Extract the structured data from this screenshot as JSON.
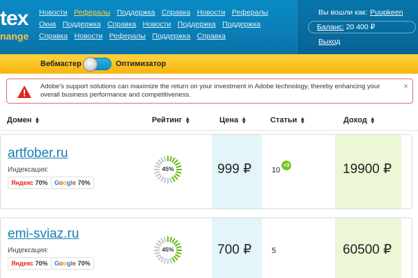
{
  "header": {
    "logo_main": "tex",
    "logo_sub": "nange",
    "nav_items": [
      {
        "label": "Новости",
        "active": false
      },
      {
        "label": "Рефералы",
        "active": true
      },
      {
        "label": "Поддержка",
        "active": false
      },
      {
        "label": "Справка",
        "active": false
      },
      {
        "label": "Новости",
        "active": false
      },
      {
        "label": "Рефералы",
        "active": false
      },
      {
        "label": "Окна",
        "active": false
      },
      {
        "label": "Поддержка",
        "active": false
      },
      {
        "label": "Справка",
        "active": false
      },
      {
        "label": "Новости",
        "active": false
      },
      {
        "label": "Поддержка",
        "active": false
      },
      {
        "label": "Поддержка",
        "active": false
      },
      {
        "label": "Справка",
        "active": false
      },
      {
        "label": "Новости",
        "active": false
      },
      {
        "label": "Рефералы",
        "active": false
      },
      {
        "label": "Поддержка",
        "active": false
      },
      {
        "label": "Справка",
        "active": false
      }
    ],
    "user": {
      "logged_in_label": "Вы вошли как:",
      "username": "Puupkeen",
      "balance_label": "Баланс:",
      "balance_value": "20 400 ₽",
      "logout_label": "Выход"
    }
  },
  "mode_toggle": {
    "left_label": "Вебмастер",
    "right_label": "Оптимизатор"
  },
  "alert": {
    "text": "Adobe's support solutions can maximize the return on your investment in Adobe technology, thereby enhancing your overall business performance and competitiveness.",
    "close_label": "×"
  },
  "table": {
    "headers": {
      "domain": "Домен",
      "rating": "Рейтинг",
      "price": "Цена",
      "articles": "Статьи",
      "income": "Доход"
    },
    "rows": [
      {
        "domain": "artfober.ru",
        "index_label": "Индексация:",
        "yandex": "70%",
        "google": "70%",
        "rating_percent": 45,
        "rating_label": "45%",
        "price": "999 ₽",
        "articles": "10",
        "articles_badge": "+3",
        "income": "19900 ₽"
      },
      {
        "domain": "emi-sviaz.ru",
        "index_label": "Индексация:",
        "yandex": "70%",
        "google": "70%",
        "rating_percent": 45,
        "rating_label": "45%",
        "price": "700 ₽",
        "articles": "5",
        "articles_badge": "",
        "income": "60500 ₽"
      }
    ]
  },
  "brands": {
    "yandex": "Яндекс",
    "google": [
      "G",
      "o",
      "o",
      "g",
      "l",
      "e"
    ]
  },
  "colors": {
    "header_blue": "#0b7fb8",
    "mode_yellow": "#f7b40e",
    "link_blue": "#1a80b6",
    "active_nav": "#ffd34a",
    "price_bg": "#e4f5fa",
    "income_bg": "#ebf7d5",
    "gauge_green": "#6dbb1f",
    "alert_red": "#e02424"
  },
  "icons": {
    "alert": "warning-triangle-icon",
    "sort": "sort-arrows-icon",
    "close": "close-icon"
  }
}
